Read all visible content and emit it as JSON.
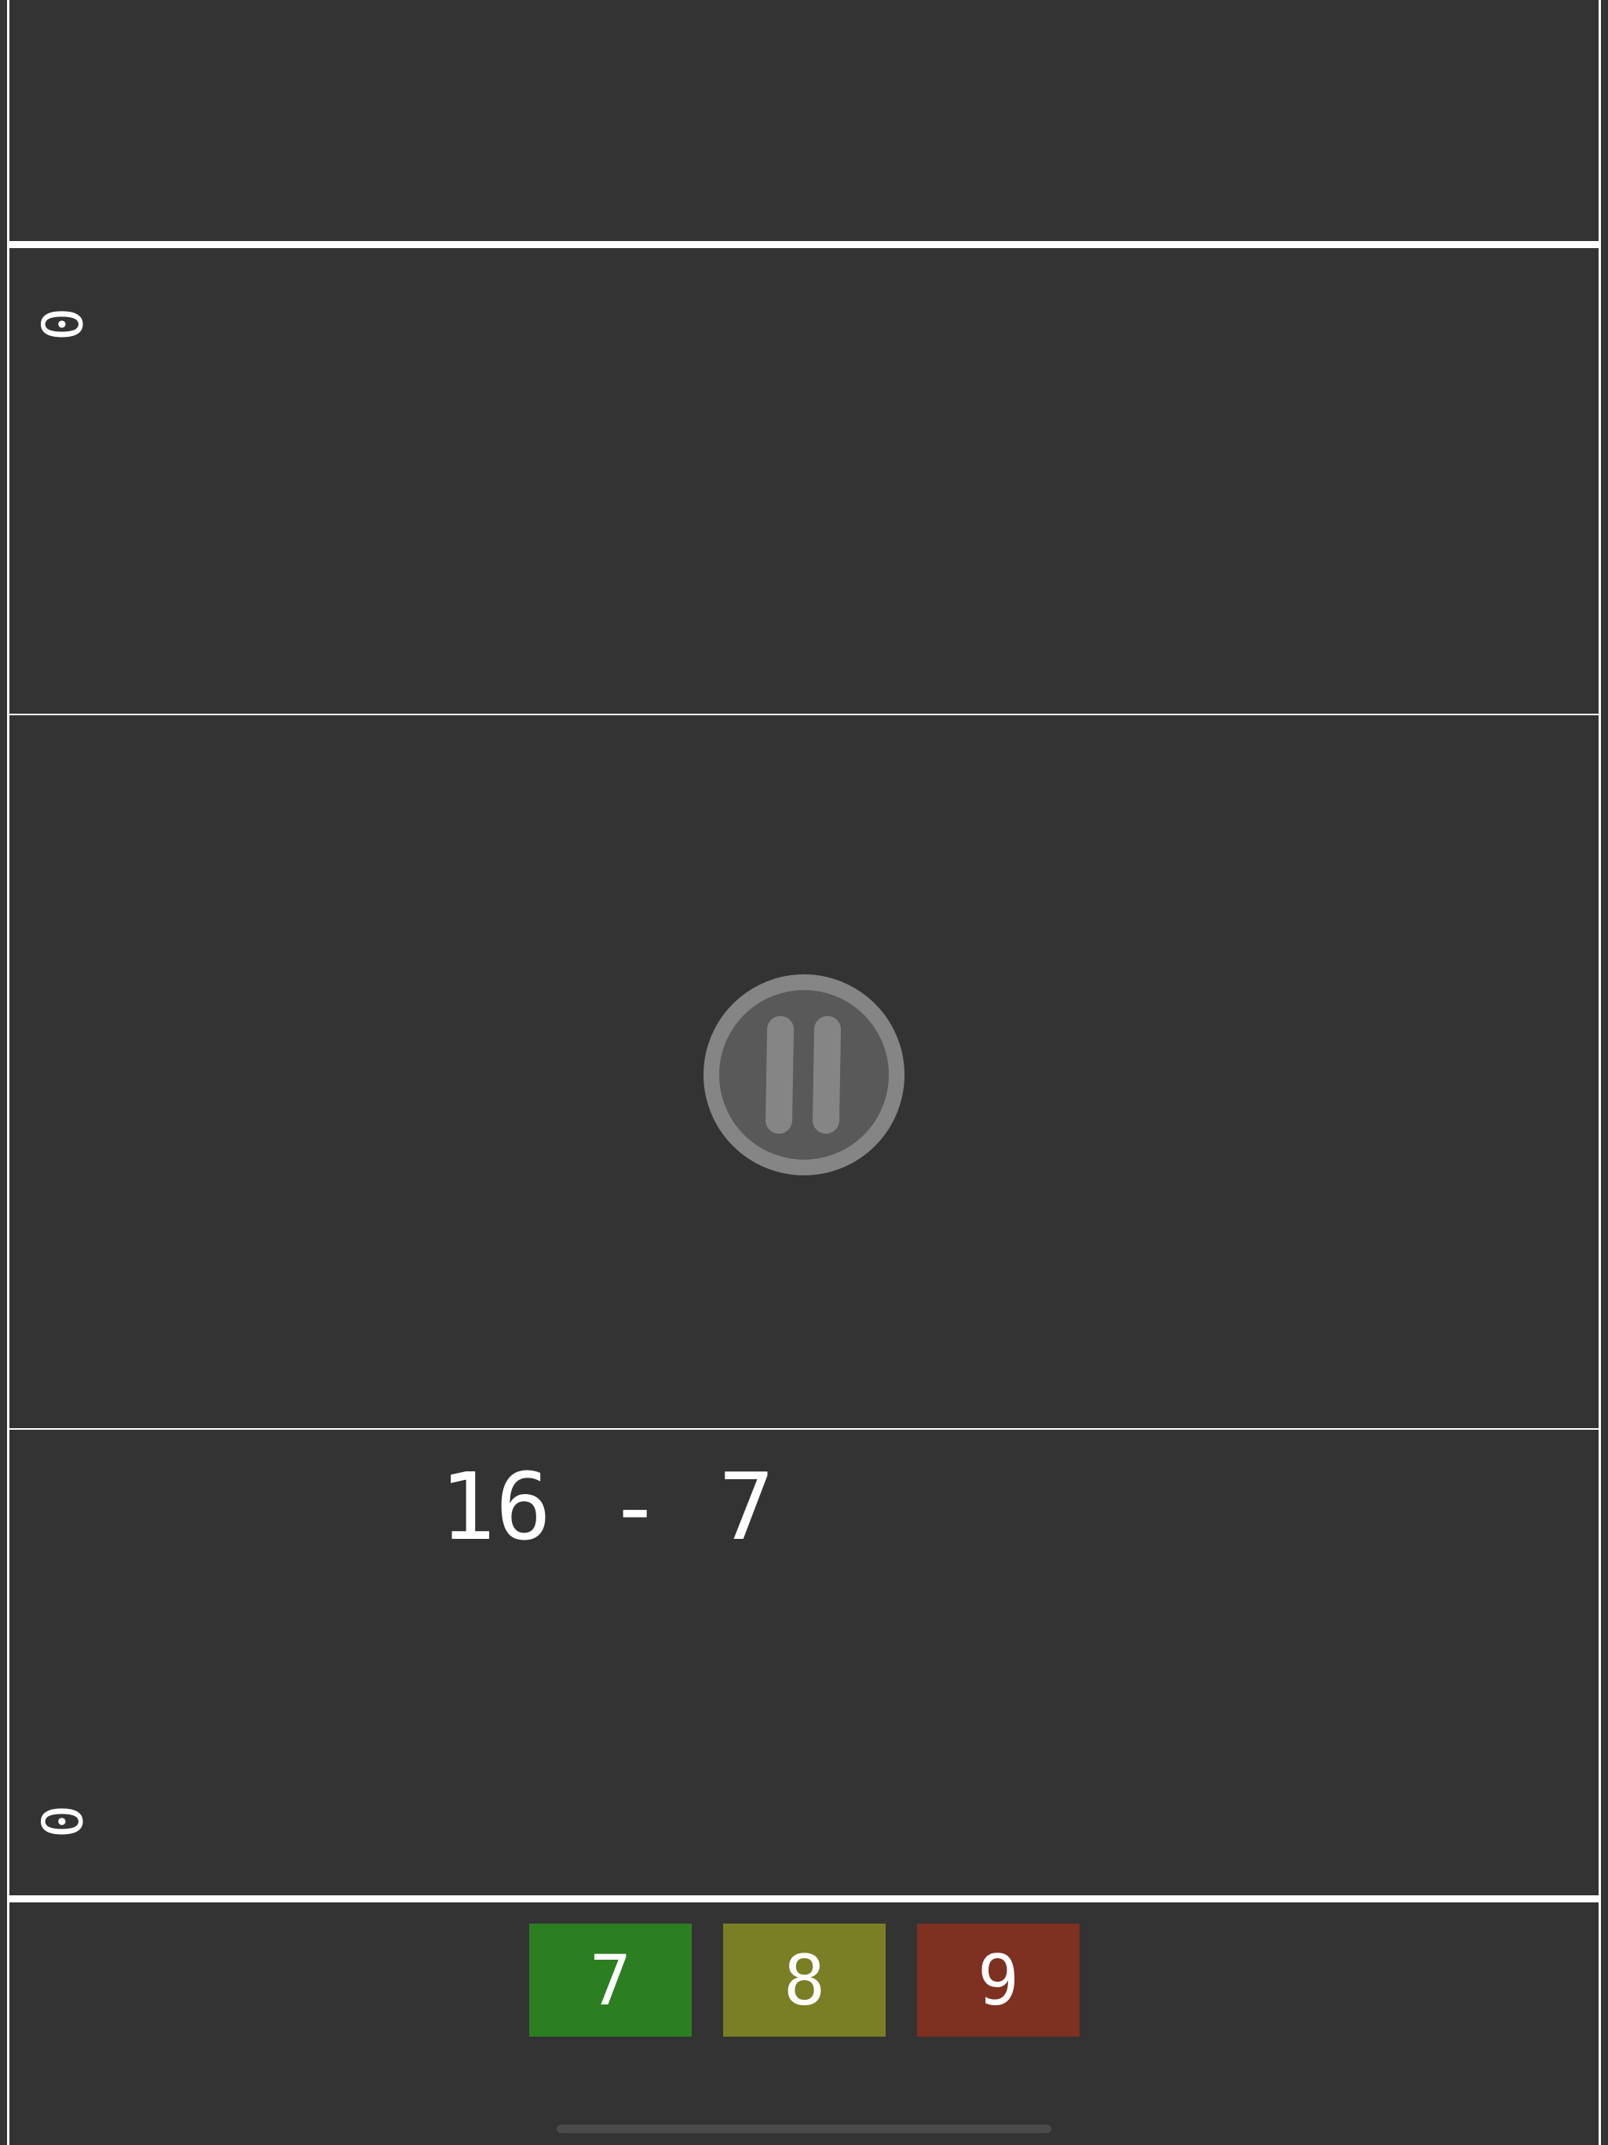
{
  "opponent": {
    "score": "0"
  },
  "player": {
    "score": "0"
  },
  "problem": {
    "text": "16 - 7"
  },
  "answers": [
    {
      "label": "7",
      "color": "#2b7f20"
    },
    {
      "label": "8",
      "color": "#7a7f25"
    },
    {
      "label": "9",
      "color": "#7e3021"
    }
  ],
  "colors": {
    "background": "#333333",
    "lines": "#ffffff",
    "pause_ring": "#858585",
    "pause_fill": "#595959"
  }
}
